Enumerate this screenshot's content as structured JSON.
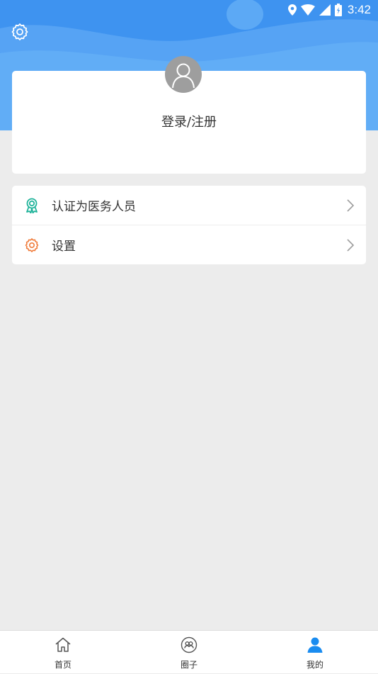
{
  "status_bar": {
    "time": "3:42"
  },
  "profile": {
    "login_label": "登录/注册"
  },
  "menu": {
    "items": [
      {
        "label": "认证为医务人员",
        "icon": "medal-icon",
        "icon_color": "#1fb39a"
      },
      {
        "label": "设置",
        "icon": "gear-icon",
        "icon_color": "#f07b3a"
      }
    ]
  },
  "bottom_nav": {
    "items": [
      {
        "label": "首页",
        "icon": "home-icon"
      },
      {
        "label": "圈子",
        "icon": "circle-group-icon"
      },
      {
        "label": "我的",
        "icon": "person-icon",
        "active": true
      }
    ]
  },
  "colors": {
    "header_blue": "#4a9cf2",
    "active_blue": "#1a8cf0",
    "background": "#ececec"
  }
}
